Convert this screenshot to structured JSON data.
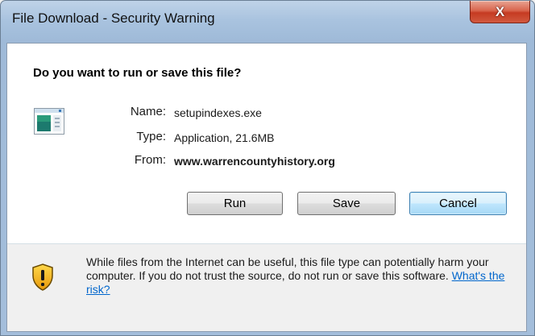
{
  "window": {
    "title": "File Download - Security Warning",
    "close_label": "X"
  },
  "dialog": {
    "question": "Do you want to run or save this file?",
    "file": {
      "name_label": "Name:",
      "name_value": "setupindexes.exe",
      "type_label": "Type:",
      "type_value": "Application, 21.6MB",
      "from_label": "From:",
      "from_value": "www.warrencountyhistory.org",
      "icon": "application-icon"
    },
    "buttons": {
      "run": "Run",
      "save": "Save",
      "cancel": "Cancel"
    },
    "warning": {
      "icon": "shield-warning-icon",
      "text": "While files from the Internet can be useful, this file type can potentially harm your computer. If you do not trust the source, do not run or save this software.",
      "link": "What's the risk?"
    }
  },
  "colors": {
    "link": "#0066cc",
    "close_button": "#c53b22",
    "default_button_border": "#3c7fb1"
  }
}
